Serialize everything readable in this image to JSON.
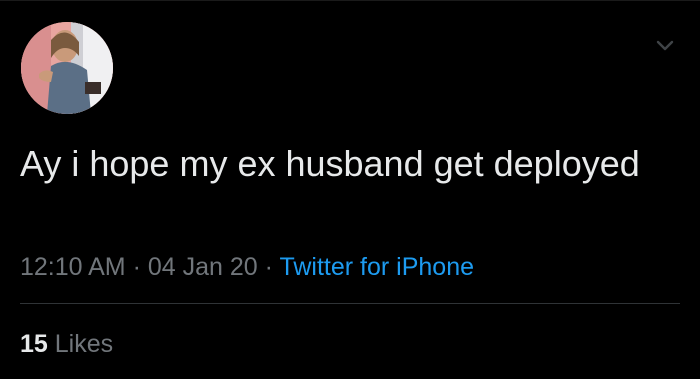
{
  "tweet": {
    "text": "Ay i hope my ex husband get deployed",
    "time": "12:10 AM",
    "date": "04 Jan 20",
    "separator": "·",
    "source": "Twitter for iPhone"
  },
  "engagement": {
    "likes_count": "15",
    "likes_label": "Likes"
  },
  "icons": {
    "avatar": "profile-photo",
    "menu": "chevron-down-icon"
  },
  "colors": {
    "background": "#000000",
    "text": "#e7e9ea",
    "secondary": "#71767b",
    "link": "#1d9bf0",
    "divider": "#2f3336"
  }
}
